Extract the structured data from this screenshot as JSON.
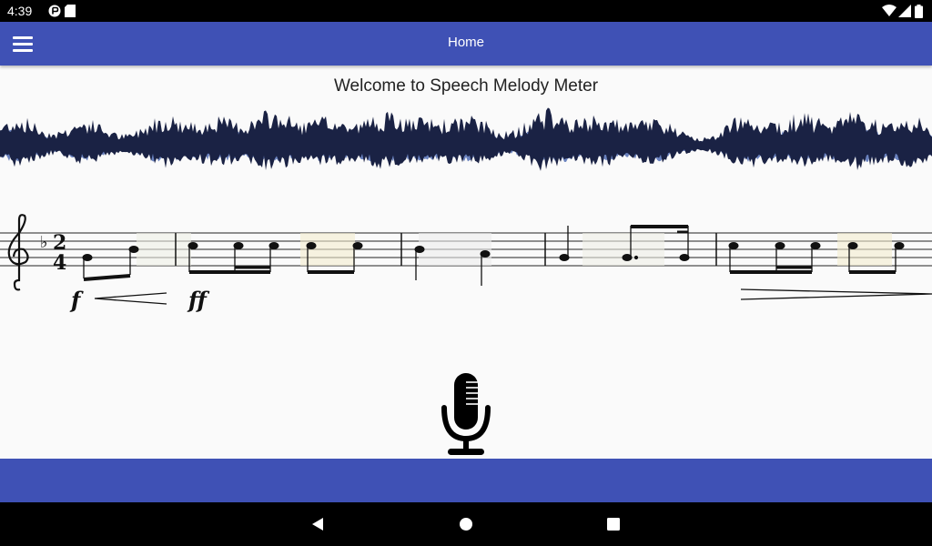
{
  "status_bar": {
    "time": "4:39",
    "icons": [
      "media-icon",
      "sd-card-icon",
      "wifi-icon",
      "signal-icon",
      "battery-icon"
    ]
  },
  "app_bar": {
    "title": "Home",
    "menu_icon": "hamburger-menu-icon",
    "color": "#3f51b5"
  },
  "main": {
    "welcome_text": "Welcome to Speech Melody Meter",
    "waveform_colors": [
      "#1a2244",
      "#4f6bb3"
    ],
    "score": {
      "key_signature": "♭",
      "time_signature": [
        "2",
        "4"
      ],
      "dynamics": [
        "f",
        "ff"
      ]
    },
    "mic_icon": "microphone-icon"
  },
  "nav_bar": {
    "buttons": [
      "back-icon",
      "home-icon",
      "recents-icon"
    ]
  }
}
